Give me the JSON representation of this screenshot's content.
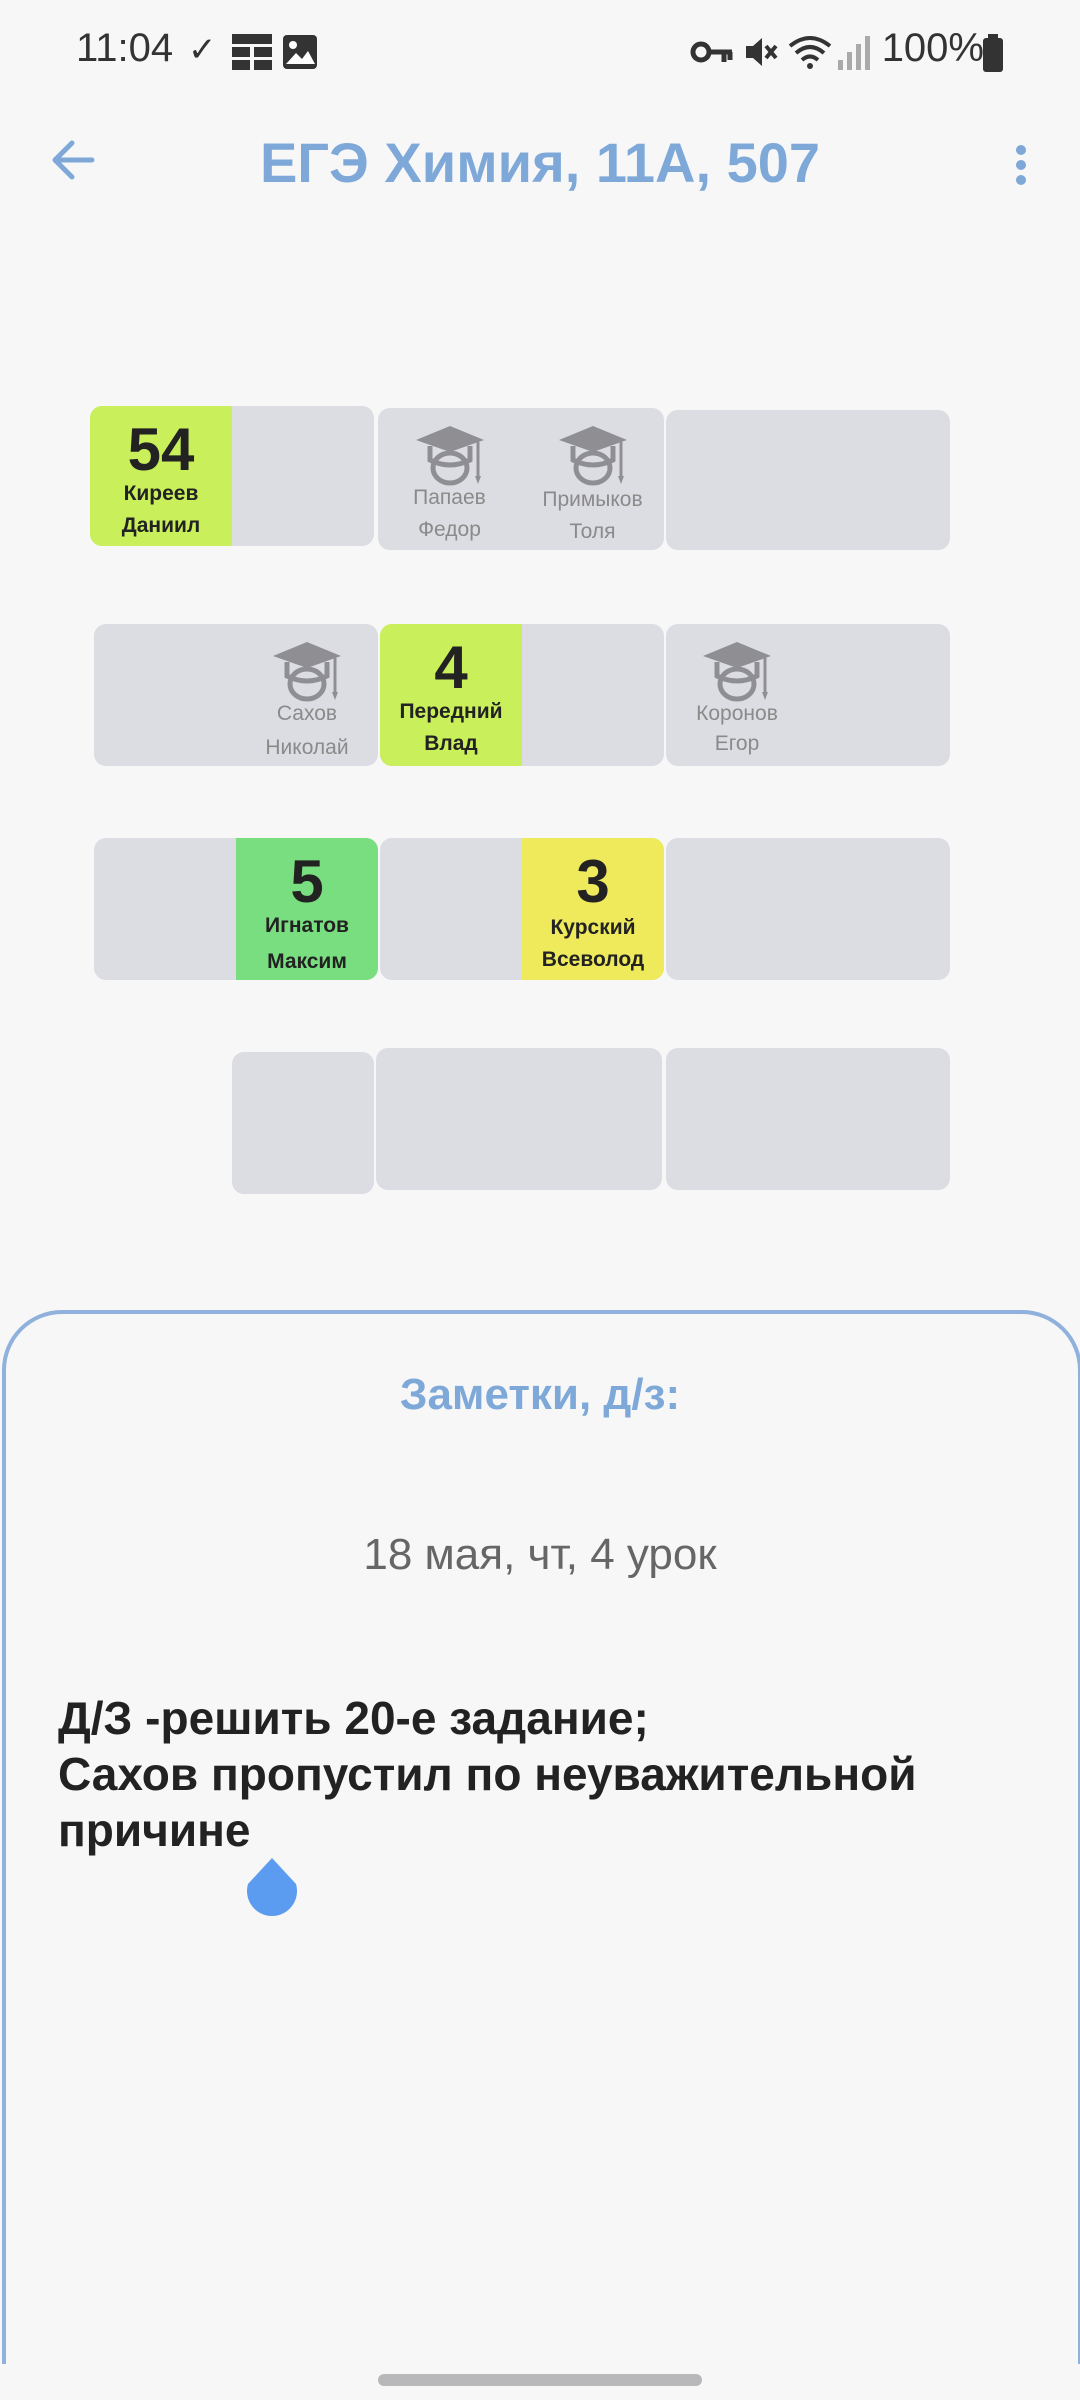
{
  "status_bar": {
    "time": "11:04",
    "battery": "100%"
  },
  "header": {
    "title": "ЕГЭ Химия, 11А, 507"
  },
  "seating": {
    "row1": {
      "desk1_left": {
        "mark": "54",
        "name1": "Киреев",
        "name2": "Даниил"
      },
      "desk2_left": {
        "name1": "Папаев",
        "name2": "Федор"
      },
      "desk2_right": {
        "name1": "Примыков",
        "name2": "Толя"
      }
    },
    "row2": {
      "desk1_right": {
        "name1": "Сахов",
        "name2": "Николай"
      },
      "desk2_left": {
        "mark": "4",
        "name1": "Передний",
        "name2": "Влад"
      },
      "desk3_left": {
        "name1": "Коронов",
        "name2": "Егор"
      }
    },
    "row3": {
      "desk1_right": {
        "mark": "5",
        "name1": "Игнатов",
        "name2": "Максим"
      },
      "desk2_right": {
        "mark": "3",
        "name1": "Курский",
        "name2": "Всеволод"
      }
    }
  },
  "notes": {
    "title": "Заметки, д/з:",
    "date": "18 мая, чт, 4 урок",
    "text": "Д/З -решить 20-е задание;\nСахов пропустил по неуважительной причине"
  },
  "colors": {
    "accent": "#7ea8d8",
    "desk": "#dcdde3",
    "lime": "#c9ef5a",
    "green": "#79de7f",
    "yellow": "#eeea5c"
  }
}
